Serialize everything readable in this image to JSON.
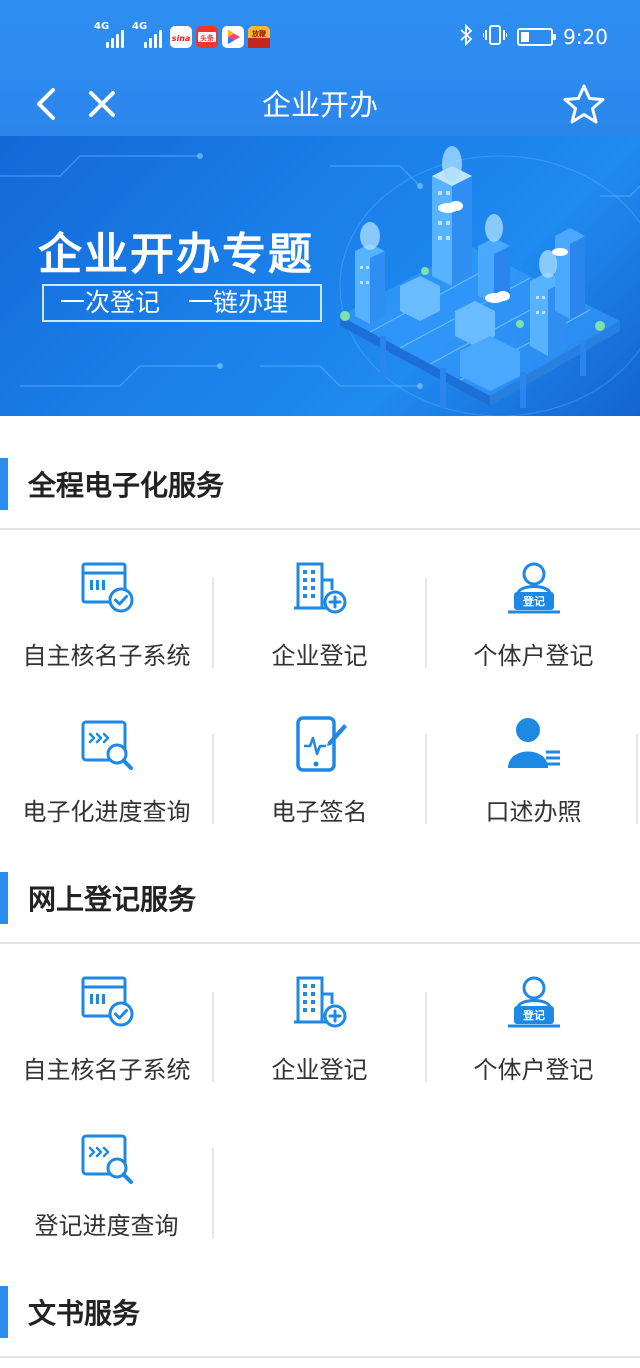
{
  "status_bar": {
    "signal_1_label": "4G",
    "signal_2_label": "4G",
    "time": "9:20",
    "icons": [
      "sina-app-icon",
      "toutiao-app-icon",
      "video-app-icon",
      "game-app-icon",
      "bluetooth-icon",
      "vibrate-icon",
      "battery-icon"
    ],
    "app_icon_labels": [
      "sina",
      "头条",
      "",
      "放鞭"
    ]
  },
  "nav": {
    "title": "企业开办",
    "back_icon": "chevron-left-icon",
    "close_icon": "close-icon",
    "favorite_icon": "star-outline-icon"
  },
  "banner": {
    "title": "企业开办专题",
    "subtitle_1": "一次登记",
    "subtitle_2": "一链办理"
  },
  "sections": [
    {
      "title": "全程电子化服务",
      "items": [
        {
          "label": "自主核名子系统",
          "icon": "name-check-icon"
        },
        {
          "label": "企业登记",
          "icon": "building-add-icon"
        },
        {
          "label": "个体户登记",
          "icon": "person-register-icon"
        },
        {
          "label": "电子化进度查询",
          "icon": "progress-search-icon"
        },
        {
          "label": "电子签名",
          "icon": "tablet-signature-icon"
        },
        {
          "label": "口述办照",
          "icon": "person-list-icon"
        }
      ]
    },
    {
      "title": "网上登记服务",
      "items": [
        {
          "label": "自主核名子系统",
          "icon": "name-check-icon"
        },
        {
          "label": "企业登记",
          "icon": "building-add-icon"
        },
        {
          "label": "个体户登记",
          "icon": "person-register-icon"
        },
        {
          "label": "登记进度查询",
          "icon": "progress-search-icon"
        }
      ]
    },
    {
      "title": "文书服务",
      "items": []
    }
  ],
  "icon_badge_text": "登记",
  "colors": {
    "primary": "#2d8cf0",
    "header": "#2f8ef1",
    "icon": "#1e88e5",
    "divider": "#e6e6e6"
  }
}
